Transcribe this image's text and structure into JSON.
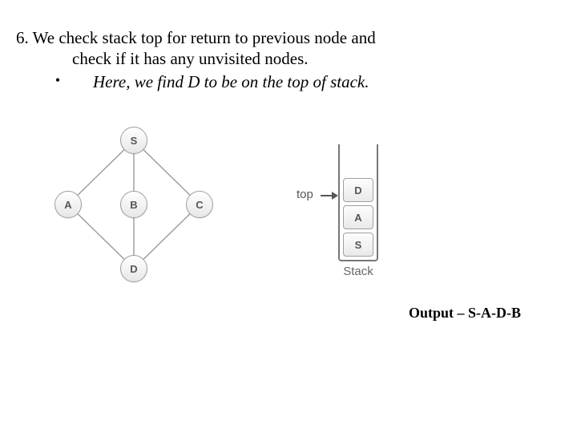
{
  "step": {
    "number": "6.",
    "line1": "6. We check stack top for return to previous node and",
    "line2": "check if it has any unvisited nodes.",
    "bullet_char": "•",
    "bullet_text": "Here, we find D to be on the top of stack."
  },
  "graph": {
    "nodes": {
      "S": "S",
      "A": "A",
      "B": "B",
      "C": "C",
      "D": "D"
    }
  },
  "stack": {
    "label": "Stack",
    "top_label": "top",
    "cells": [
      "D",
      "A",
      "S"
    ]
  },
  "output": {
    "text": "Output – S-A-D-B",
    "sequence": [
      "S",
      "A",
      "D",
      "B"
    ]
  }
}
